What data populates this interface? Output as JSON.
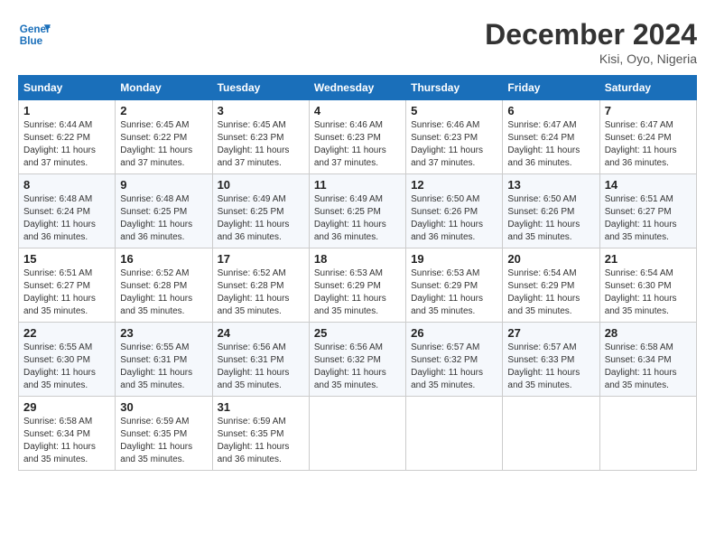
{
  "logo": {
    "text_general": "General",
    "text_blue": "Blue"
  },
  "title": "December 2024",
  "location": "Kisi, Oyo, Nigeria",
  "days_of_week": [
    "Sunday",
    "Monday",
    "Tuesday",
    "Wednesday",
    "Thursday",
    "Friday",
    "Saturday"
  ],
  "weeks": [
    [
      {
        "day": "1",
        "sunrise": "6:44 AM",
        "sunset": "6:22 PM",
        "daylight": "11 hours and 37 minutes."
      },
      {
        "day": "2",
        "sunrise": "6:45 AM",
        "sunset": "6:22 PM",
        "daylight": "11 hours and 37 minutes."
      },
      {
        "day": "3",
        "sunrise": "6:45 AM",
        "sunset": "6:23 PM",
        "daylight": "11 hours and 37 minutes."
      },
      {
        "day": "4",
        "sunrise": "6:46 AM",
        "sunset": "6:23 PM",
        "daylight": "11 hours and 37 minutes."
      },
      {
        "day": "5",
        "sunrise": "6:46 AM",
        "sunset": "6:23 PM",
        "daylight": "11 hours and 37 minutes."
      },
      {
        "day": "6",
        "sunrise": "6:47 AM",
        "sunset": "6:24 PM",
        "daylight": "11 hours and 36 minutes."
      },
      {
        "day": "7",
        "sunrise": "6:47 AM",
        "sunset": "6:24 PM",
        "daylight": "11 hours and 36 minutes."
      }
    ],
    [
      {
        "day": "8",
        "sunrise": "6:48 AM",
        "sunset": "6:24 PM",
        "daylight": "11 hours and 36 minutes."
      },
      {
        "day": "9",
        "sunrise": "6:48 AM",
        "sunset": "6:25 PM",
        "daylight": "11 hours and 36 minutes."
      },
      {
        "day": "10",
        "sunrise": "6:49 AM",
        "sunset": "6:25 PM",
        "daylight": "11 hours and 36 minutes."
      },
      {
        "day": "11",
        "sunrise": "6:49 AM",
        "sunset": "6:25 PM",
        "daylight": "11 hours and 36 minutes."
      },
      {
        "day": "12",
        "sunrise": "6:50 AM",
        "sunset": "6:26 PM",
        "daylight": "11 hours and 36 minutes."
      },
      {
        "day": "13",
        "sunrise": "6:50 AM",
        "sunset": "6:26 PM",
        "daylight": "11 hours and 35 minutes."
      },
      {
        "day": "14",
        "sunrise": "6:51 AM",
        "sunset": "6:27 PM",
        "daylight": "11 hours and 35 minutes."
      }
    ],
    [
      {
        "day": "15",
        "sunrise": "6:51 AM",
        "sunset": "6:27 PM",
        "daylight": "11 hours and 35 minutes."
      },
      {
        "day": "16",
        "sunrise": "6:52 AM",
        "sunset": "6:28 PM",
        "daylight": "11 hours and 35 minutes."
      },
      {
        "day": "17",
        "sunrise": "6:52 AM",
        "sunset": "6:28 PM",
        "daylight": "11 hours and 35 minutes."
      },
      {
        "day": "18",
        "sunrise": "6:53 AM",
        "sunset": "6:29 PM",
        "daylight": "11 hours and 35 minutes."
      },
      {
        "day": "19",
        "sunrise": "6:53 AM",
        "sunset": "6:29 PM",
        "daylight": "11 hours and 35 minutes."
      },
      {
        "day": "20",
        "sunrise": "6:54 AM",
        "sunset": "6:29 PM",
        "daylight": "11 hours and 35 minutes."
      },
      {
        "day": "21",
        "sunrise": "6:54 AM",
        "sunset": "6:30 PM",
        "daylight": "11 hours and 35 minutes."
      }
    ],
    [
      {
        "day": "22",
        "sunrise": "6:55 AM",
        "sunset": "6:30 PM",
        "daylight": "11 hours and 35 minutes."
      },
      {
        "day": "23",
        "sunrise": "6:55 AM",
        "sunset": "6:31 PM",
        "daylight": "11 hours and 35 minutes."
      },
      {
        "day": "24",
        "sunrise": "6:56 AM",
        "sunset": "6:31 PM",
        "daylight": "11 hours and 35 minutes."
      },
      {
        "day": "25",
        "sunrise": "6:56 AM",
        "sunset": "6:32 PM",
        "daylight": "11 hours and 35 minutes."
      },
      {
        "day": "26",
        "sunrise": "6:57 AM",
        "sunset": "6:32 PM",
        "daylight": "11 hours and 35 minutes."
      },
      {
        "day": "27",
        "sunrise": "6:57 AM",
        "sunset": "6:33 PM",
        "daylight": "11 hours and 35 minutes."
      },
      {
        "day": "28",
        "sunrise": "6:58 AM",
        "sunset": "6:34 PM",
        "daylight": "11 hours and 35 minutes."
      }
    ],
    [
      {
        "day": "29",
        "sunrise": "6:58 AM",
        "sunset": "6:34 PM",
        "daylight": "11 hours and 35 minutes."
      },
      {
        "day": "30",
        "sunrise": "6:59 AM",
        "sunset": "6:35 PM",
        "daylight": "11 hours and 35 minutes."
      },
      {
        "day": "31",
        "sunrise": "6:59 AM",
        "sunset": "6:35 PM",
        "daylight": "11 hours and 36 minutes."
      },
      null,
      null,
      null,
      null
    ]
  ]
}
